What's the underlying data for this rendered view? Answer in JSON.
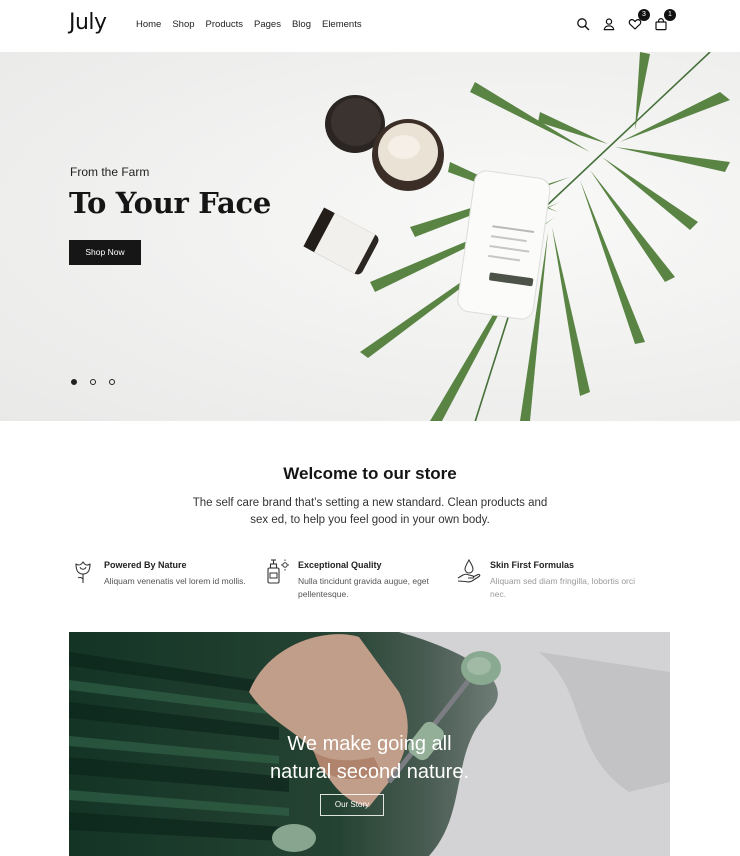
{
  "header": {
    "logo": "July",
    "nav": [
      "Home",
      "Shop",
      "Products",
      "Pages",
      "Blog",
      "Elements"
    ],
    "wishlist_count": "3",
    "cart_count": "1"
  },
  "hero": {
    "eyebrow": "From the Farm",
    "title": "To Your Face",
    "button_label": "Shop Now",
    "slides": 3,
    "active_slide": 1
  },
  "welcome": {
    "title": "Welcome to our store",
    "text": "The self care brand that’s setting a new standard. Clean products and sex ed, to help you feel good in your own body."
  },
  "features": [
    {
      "icon": "rose-icon",
      "title": "Powered By Nature",
      "desc": "Aliquam venenatis vel lorem id mollis."
    },
    {
      "icon": "bottle-icon",
      "title": "Exceptional Quality",
      "desc": "Nulla tincidunt gravida augue, eget pellentesque."
    },
    {
      "icon": "hand-drop-icon",
      "title": "Skin First Formulas",
      "desc": "Aliquam sed diam fringilla, lobortis orci nec."
    }
  ],
  "banner": {
    "line1": "We make going all",
    "line2": "natural second nature.",
    "button_label": "Our Story"
  },
  "colors": {
    "primary": "#161616",
    "hero_bg": "#efefef",
    "leaf": "#4f7a3a"
  }
}
